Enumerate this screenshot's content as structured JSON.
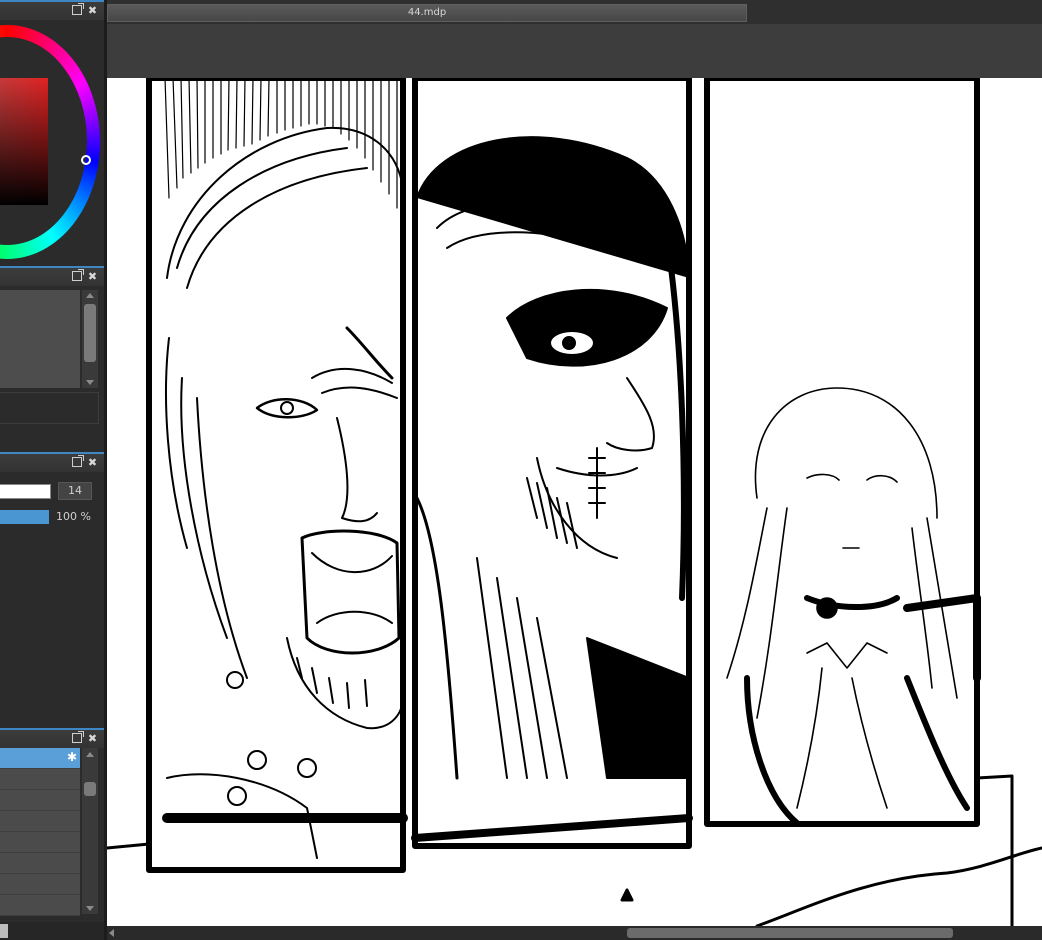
{
  "document": {
    "tab_title": "44.mdp"
  },
  "brush": {
    "size": "14",
    "opacity": "100 %"
  },
  "icons": {
    "float": "float-window-icon",
    "close": "close-icon",
    "gear": "gear-icon"
  },
  "colors": {
    "accent": "#3e86c4",
    "selection": "#5b9fd8",
    "primary_color": "#e02222",
    "panel_bg": "#2b2b2b"
  }
}
